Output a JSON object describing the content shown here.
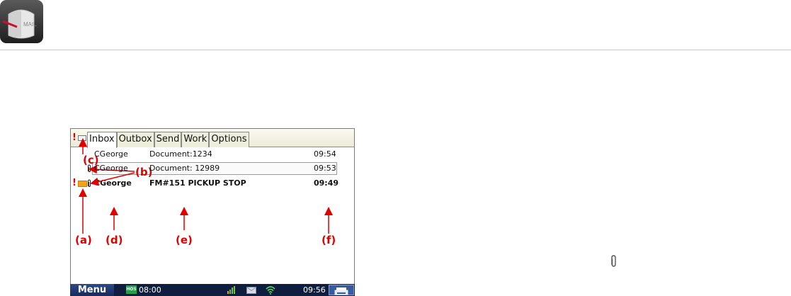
{
  "app": {
    "icon_text": "MAIL"
  },
  "device": {
    "alert_mark": "!",
    "tabs": [
      {
        "label": "Inbox",
        "active": true
      },
      {
        "label": "Outbox",
        "active": false
      },
      {
        "label": "Send",
        "active": false
      },
      {
        "label": "Work",
        "active": false
      },
      {
        "label": "Options",
        "active": false
      }
    ],
    "messages": [
      {
        "from": "CGeorge",
        "subject": "Document:1234",
        "time": "09:54",
        "unread": false,
        "urgent": false,
        "attachment": false,
        "selected": false
      },
      {
        "from": "CGeorge",
        "subject": "Document: 12989",
        "time": "09:53",
        "unread": false,
        "urgent": false,
        "attachment": true,
        "selected": true
      },
      {
        "from": "CGeorge",
        "subject": "FM#151 PICKUP STOP",
        "time": "09:49",
        "unread": true,
        "urgent": true,
        "attachment": true,
        "selected": false
      }
    ],
    "taskbar": {
      "menu_label": "Menu",
      "hos_badge": "HOS",
      "hos_time": "08:00",
      "clock": "09:56"
    }
  },
  "annotations": {
    "a": "(a)",
    "b": "(b)",
    "c": "(c)",
    "d": "(d)",
    "e": "(e)",
    "f": "(f)"
  },
  "colors": {
    "annotation": "#e00000",
    "taskbar": "#0f1d3e",
    "unread_envelope": "#f3a21c"
  }
}
